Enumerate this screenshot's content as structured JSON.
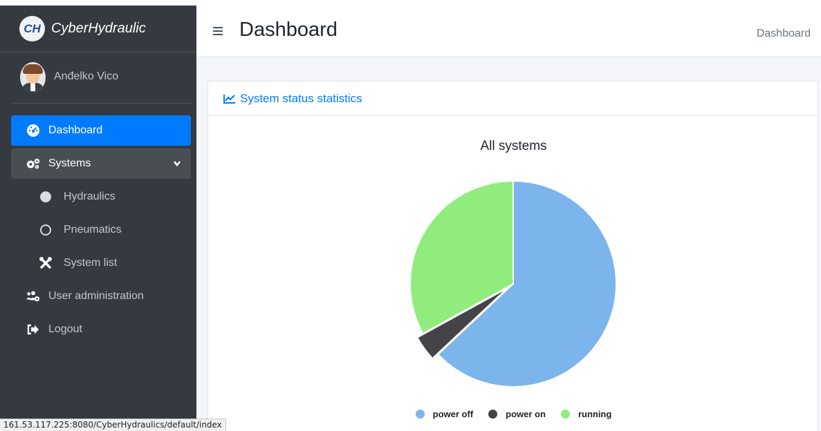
{
  "brand": {
    "logo": "CH",
    "name": "CyberHydraulic"
  },
  "user": {
    "name": "Anđelko Vico"
  },
  "nav": {
    "items": [
      {
        "label": "Dashboard",
        "icon": "tachometer-icon",
        "active": true
      },
      {
        "label": "Systems",
        "icon": "cogs-icon",
        "expanded": true
      },
      {
        "label": "Hydraulics",
        "icon": "filled-circle-icon"
      },
      {
        "label": "Pneumatics",
        "icon": "empty-circle-icon"
      },
      {
        "label": "System list",
        "icon": "tools-icon"
      },
      {
        "label": "User administration",
        "icon": "users-cog-icon"
      },
      {
        "label": "Logout",
        "icon": "sign-out-icon"
      }
    ]
  },
  "header": {
    "title": "Dashboard",
    "breadcrumb": "Dashboard"
  },
  "card": {
    "title": "System status statistics",
    "icon": "chart-line-icon"
  },
  "chart_data": {
    "type": "pie",
    "title": "All systems",
    "legend_position": "bottom",
    "categories": [
      "power off",
      "power on",
      "running"
    ],
    "values": [
      63,
      4,
      33
    ],
    "colors": [
      "#7cb5ec",
      "#434348",
      "#90ed7d"
    ],
    "exploded": "power on"
  },
  "status_bar": {
    "url": "161.53.117.225:8080/CyberHydraulics/default/index"
  }
}
